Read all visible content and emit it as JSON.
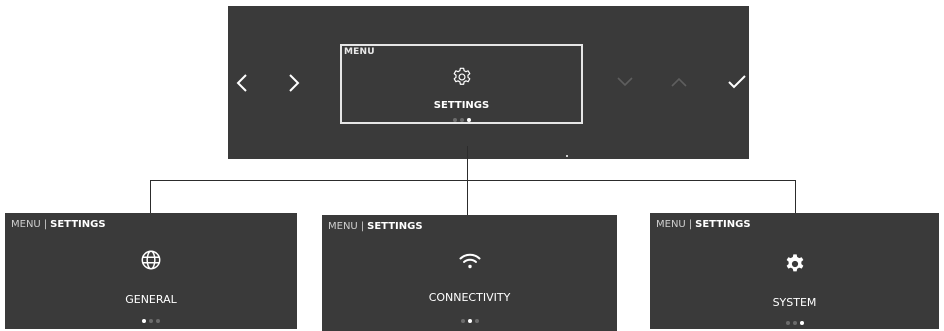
{
  "main": {
    "menu_label": "MENU",
    "title": "SETTINGS",
    "page_dots": {
      "count": 3,
      "active_index": 2
    },
    "nav": [
      {
        "name": "back-chevron-icon",
        "enabled": true
      },
      {
        "name": "forward-chevron-icon",
        "enabled": true
      },
      {
        "name": "down-chevron-icon",
        "enabled": false
      },
      {
        "name": "up-chevron-icon",
        "enabled": false
      },
      {
        "name": "check-icon",
        "enabled": true
      }
    ],
    "icon": "gear-outline-icon"
  },
  "subscreens": [
    {
      "menu": "MENU",
      "separator": "|",
      "section": "SETTINGS",
      "title": "GENERAL",
      "icon": "globe-icon",
      "active_dot": 0
    },
    {
      "menu": "MENU",
      "separator": "|",
      "section": "SETTINGS",
      "title": "CONNECTIVITY",
      "icon": "wifi-icon",
      "active_dot": 1
    },
    {
      "menu": "MENU",
      "separator": "|",
      "section": "SETTINGS",
      "title": "SYSTEM",
      "icon": "gear-icon",
      "active_dot": 2
    }
  ],
  "colors": {
    "panel_bg": "#3a3a3a",
    "text": "#ffffff",
    "disabled": "#5e5e5e",
    "connector": "#2c2c2c"
  }
}
